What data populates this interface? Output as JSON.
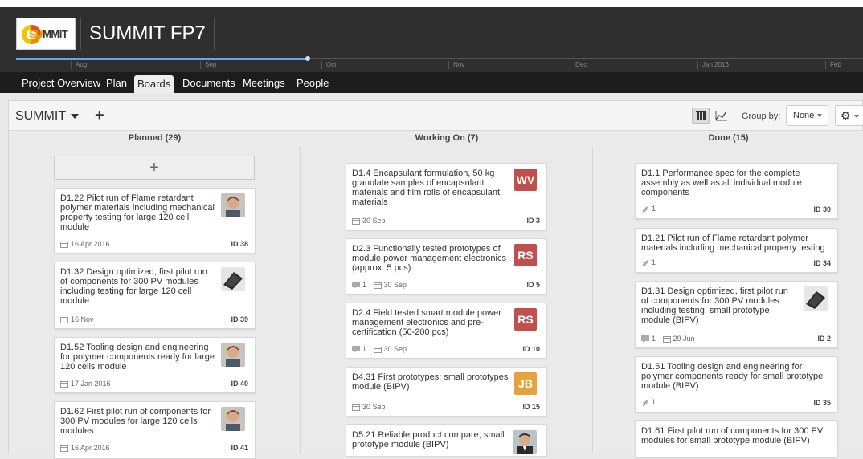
{
  "header": {
    "logo_text_a": "SU",
    "logo_text_b": "MMIT",
    "app_title": "SUMMIT FP7",
    "timeline_months": [
      "Aug",
      "Sep",
      "Oct",
      "Nov",
      "Dec",
      "Jan 2016",
      "Feb"
    ]
  },
  "nav": {
    "items": [
      "Project Overview",
      "Plan",
      "Boards",
      "Documents",
      "Meetings",
      "People"
    ],
    "active": "Boards"
  },
  "toolbar": {
    "board_name": "SUMMIT",
    "add_label": "+",
    "group_by_label": "Group by:",
    "group_by_value": "None",
    "gear_glyph": "⚙"
  },
  "columns": [
    {
      "title": "Planned (29)",
      "add_label": "+",
      "cards": [
        {
          "title": "D1.22 Pilot run of Flame retardant polymer materials including mechanical property testing for large 120 cell module",
          "date": "16 Apr 2016",
          "id": "ID 38",
          "avatar": "person-photo"
        },
        {
          "title": "D1.32 Design optimized, first pilot run of components for 300 PV modules including testing for large 120 cell module",
          "date": "16 Nov",
          "id": "ID 39",
          "avatar": "module-photo"
        },
        {
          "title": "D1.52 Tooling design and engineering for polymer components ready for large 120 cells module",
          "date": "17 Jan 2016",
          "id": "ID 40",
          "avatar": "person-photo"
        },
        {
          "title": "D1.62 First pilot run of components for 300 PV modules for large 120 cells modules",
          "date": "16 Apr 2016",
          "id": "ID 41",
          "avatar": "person-photo"
        }
      ]
    },
    {
      "title": "Working On (7)",
      "cards": [
        {
          "title": "D1.4 Encapsulant formulation, 50 kg granulate samples of encapsulant materials and film rolls of encapsulant materials",
          "date": "30 Sep",
          "id": "ID 3",
          "badge": "WV",
          "badge_color": "#c0504d"
        },
        {
          "title": "D2.3 Functionally tested prototypes of module power management electronics (approx. 5 pcs)",
          "comments": "1",
          "date": "30 Sep",
          "id": "ID 5",
          "badge": "RS",
          "badge_color": "#c0504d"
        },
        {
          "title": "D2.4 Field tested smart module power management electronics and pre-certification (50-200 pcs)",
          "comments": "1",
          "date": "30 Sep",
          "id": "ID 10",
          "badge": "RS",
          "badge_color": "#c0504d"
        },
        {
          "title": "D4.31 First prototypes; small prototypes module (BIPV)",
          "date": "30 Sep",
          "id": "ID 15",
          "badge": "JB",
          "badge_color": "#e6a23c"
        },
        {
          "title": "D5.21 Reliable product compare; small prototype module (BIPV)",
          "avatar": "person-suit-photo"
        }
      ]
    },
    {
      "title": "Done (15)",
      "cards": [
        {
          "title": "D1.1 Performance spec for the complete assembly as well as all individual module components",
          "attachments": "1",
          "id": "ID 30"
        },
        {
          "title": "D1.21 Pilot run of Flame retardant polymer materials including mechanical property testing",
          "attachments": "1",
          "id": "ID 34"
        },
        {
          "title": "D1.31 Design optimized, first pilot run of components for 300 PV modules including testing; small prototype module (BIPV)",
          "comments": "1",
          "date": "29 Jun",
          "id": "ID 2",
          "avatar": "module-photo"
        },
        {
          "title": "D1.51 Tooling design and engineering for polymer components ready for small prototype module (BIPV)",
          "attachments": "1",
          "id": "ID 35"
        },
        {
          "title": "D1.61 First pilot run of components for 300 PV modules for small prototype module (BIPV)"
        }
      ]
    }
  ]
}
